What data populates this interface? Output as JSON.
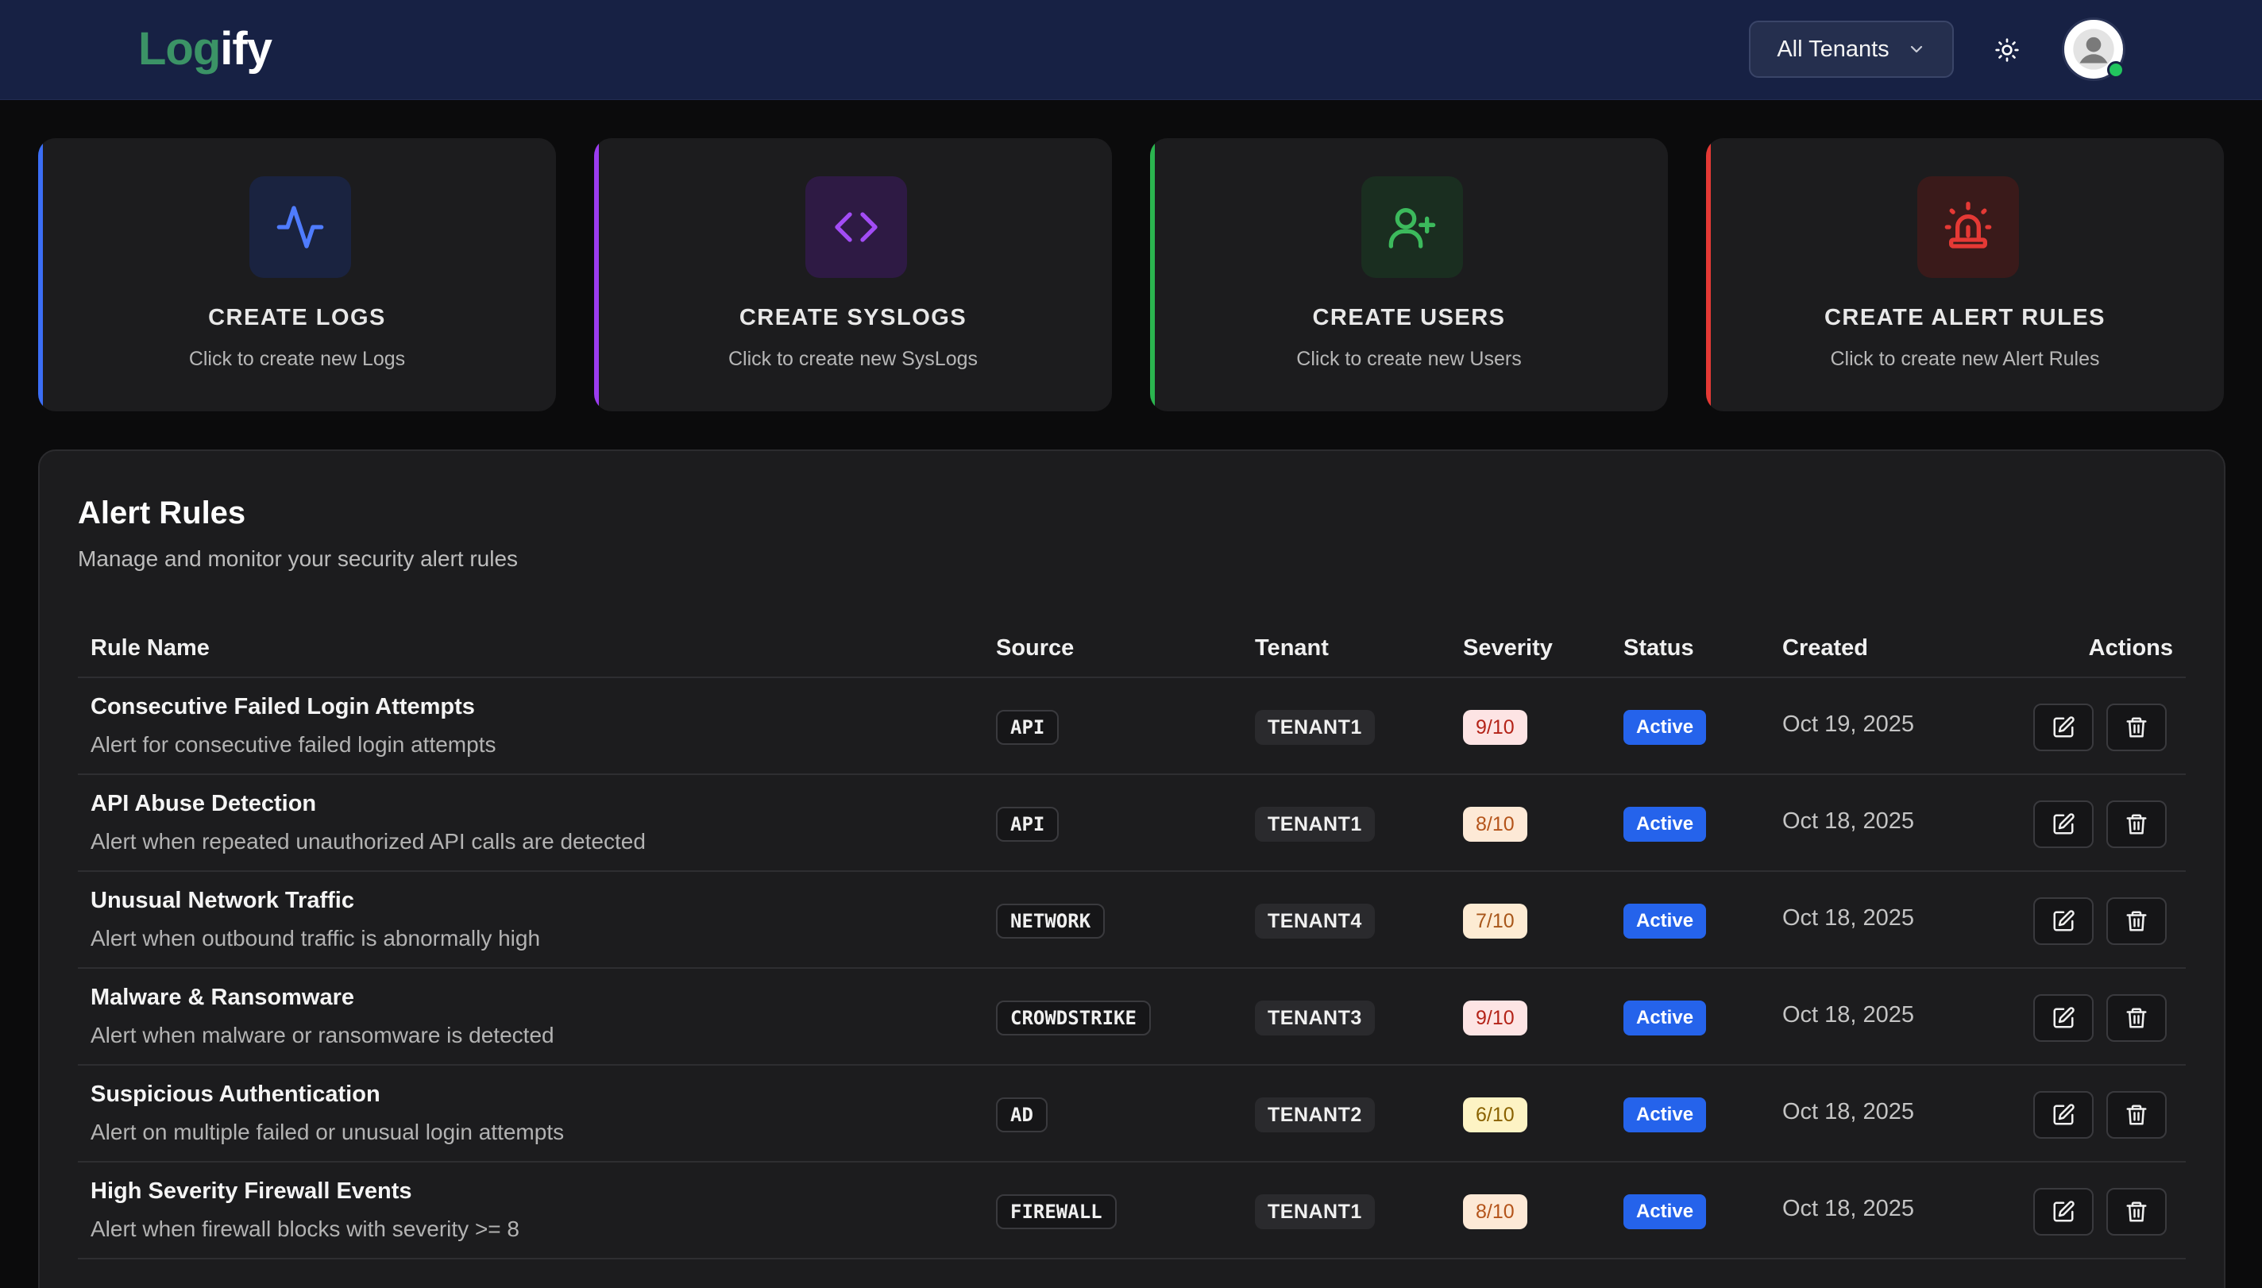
{
  "header": {
    "logo_part1": "Log",
    "logo_part2": "ify",
    "tenant_selector": "All Tenants",
    "theme_icon": "sun-icon",
    "avatar_icon": "user-avatar-icon"
  },
  "quick_actions": [
    {
      "title": "CREATE LOGS",
      "subtitle": "Click to create new Logs",
      "icon": "activity-icon",
      "accent": "#3b6ef5",
      "icon_bg": "#1a2340",
      "icon_color": "#4f7cff"
    },
    {
      "title": "CREATE SYSLOGS",
      "subtitle": "Click to create new SysLogs",
      "icon": "code-icon",
      "accent": "#9b3cf0",
      "icon_bg": "#2e1a44",
      "icon_color": "#a24cf5"
    },
    {
      "title": "CREATE USERS",
      "subtitle": "Click to create new Users",
      "icon": "user-plus-icon",
      "accent": "#2bb54f",
      "icon_bg": "#1a2e20",
      "icon_color": "#3cb95c"
    },
    {
      "title": "CREATE ALERT RULES",
      "subtitle": "Click to create new Alert Rules",
      "icon": "siren-icon",
      "accent": "#e53935",
      "icon_bg": "#3a1a1a",
      "icon_color": "#e53935"
    }
  ],
  "alert_rules": {
    "title": "Alert Rules",
    "subtitle": "Manage and monitor your security alert rules",
    "columns": [
      "Rule Name",
      "Source",
      "Tenant",
      "Severity",
      "Status",
      "Created",
      "Actions"
    ],
    "rows": [
      {
        "name": "Consecutive Failed Login Attempts",
        "description": "Alert for consecutive failed login attempts",
        "source": "API",
        "tenant": "TENANT1",
        "severity": "9/10",
        "status": "Active",
        "created": "Oct 19, 2025"
      },
      {
        "name": "API Abuse Detection",
        "description": "Alert when repeated unauthorized API calls are detected",
        "source": "API",
        "tenant": "TENANT1",
        "severity": "8/10",
        "status": "Active",
        "created": "Oct 18, 2025"
      },
      {
        "name": "Unusual Network Traffic",
        "description": "Alert when outbound traffic is abnormally high",
        "source": "NETWORK",
        "tenant": "TENANT4",
        "severity": "7/10",
        "status": "Active",
        "created": "Oct 18, 2025"
      },
      {
        "name": "Malware & Ransomware",
        "description": "Alert when malware or ransomware is detected",
        "source": "CROWDSTRIKE",
        "tenant": "TENANT3",
        "severity": "9/10",
        "status": "Active",
        "created": "Oct 18, 2025"
      },
      {
        "name": "Suspicious Authentication",
        "description": "Alert on multiple failed or unusual login attempts",
        "source": "AD",
        "tenant": "TENANT2",
        "severity": "6/10",
        "status": "Active",
        "created": "Oct 18, 2025"
      },
      {
        "name": "High Severity Firewall Events",
        "description": "Alert when firewall blocks with severity >= 8",
        "source": "FIREWALL",
        "tenant": "TENANT1",
        "severity": "8/10",
        "status": "Active",
        "created": "Oct 18, 2025"
      }
    ]
  },
  "severity_colors": {
    "9/10": {
      "bg": "#fde4e4",
      "fg": "#b42318"
    },
    "8/10": {
      "bg": "#fde9d6",
      "fg": "#b4541a"
    },
    "7/10": {
      "bg": "#fdebd3",
      "fg": "#a8561a"
    },
    "6/10": {
      "bg": "#fdf3c4",
      "fg": "#8a6200"
    }
  }
}
